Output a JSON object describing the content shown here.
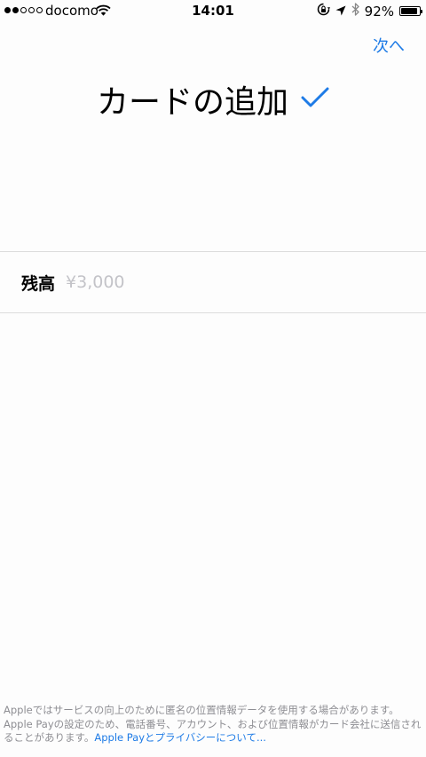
{
  "status_bar": {
    "carrier": "docomo",
    "time": "14:01",
    "battery_percent": "92%",
    "battery_level": 0.92,
    "signal_strength": 2,
    "signal_max": 5
  },
  "nav": {
    "next_label": "次へ"
  },
  "page": {
    "title": "カードの追加",
    "check_icon": "checkmark-icon",
    "accent_color": "#1e7be6"
  },
  "balance": {
    "label": "残高",
    "value": "",
    "placeholder": "¥3,000"
  },
  "footer": {
    "text": "Appleではサービスの向上のために匿名の位置情報データを使用する場合があります。Apple Payの設定のため、電話番号、アカウント、および位置情報がカード会社に送信されることがあります。",
    "link": "Apple Payとプライバシーについて..."
  }
}
